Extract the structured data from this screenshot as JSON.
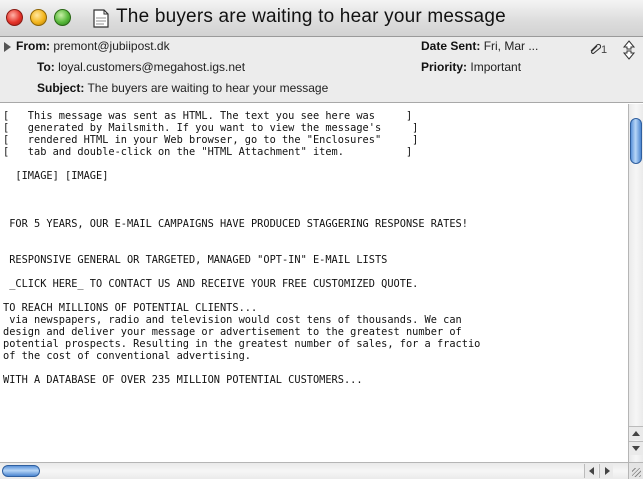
{
  "window": {
    "title": "The buyers are waiting to hear your message"
  },
  "header": {
    "from_label": "From:",
    "from_value": "premont@jubiipost.dk",
    "to_label": "To:",
    "to_value": "loyal.customers@megahost.igs.net",
    "subject_label": "Subject:",
    "subject_value": "The buyers are waiting to hear your message",
    "date_label": "Date Sent:",
    "date_value": "Fri, Mar ...",
    "priority_label": "Priority:",
    "priority_value": "Important",
    "attachment_count": "1"
  },
  "message": {
    "body": "[   This message was sent as HTML. The text you see here was     ]\n[   generated by Mailsmith. If you want to view the message's     ]\n[   rendered HTML in your Web browser, go to the \"Enclosures\"     ]\n[   tab and double-click on the \"HTML Attachment\" item.          ]\n\n  [IMAGE] [IMAGE]\n\n\n\n FOR 5 YEARS, OUR E-MAIL CAMPAIGNS HAVE PRODUCED STAGGERING RESPONSE RATES!\n\n\n RESPONSIVE GENERAL OR TARGETED, MANAGED \"OPT-IN\" E-MAIL LISTS\n\n _CLICK HERE_ TO CONTACT US AND RECEIVE YOUR FREE CUSTOMIZED QUOTE.\n\nTO REACH MILLIONS OF POTENTIAL CLIENTS...\n via newspapers, radio and television would cost tens of thousands. We can\ndesign and deliver your message or advertisement to the greatest number of\npotential prospects. Resulting in the greatest number of sales, for a fractio\nof the cost of conventional advertising.\n\nWITH A DATABASE OF OVER 235 MILLION POTENTIAL CUSTOMERS..."
  },
  "icons": {
    "close": "close-button-icon",
    "minimize": "minimize-button-icon",
    "zoom": "zoom-button-icon",
    "document": "document-icon",
    "disclosure": "disclosure-triangle-icon",
    "attachment": "paperclip-icon",
    "stepper": "stepper-arrows-icon"
  }
}
